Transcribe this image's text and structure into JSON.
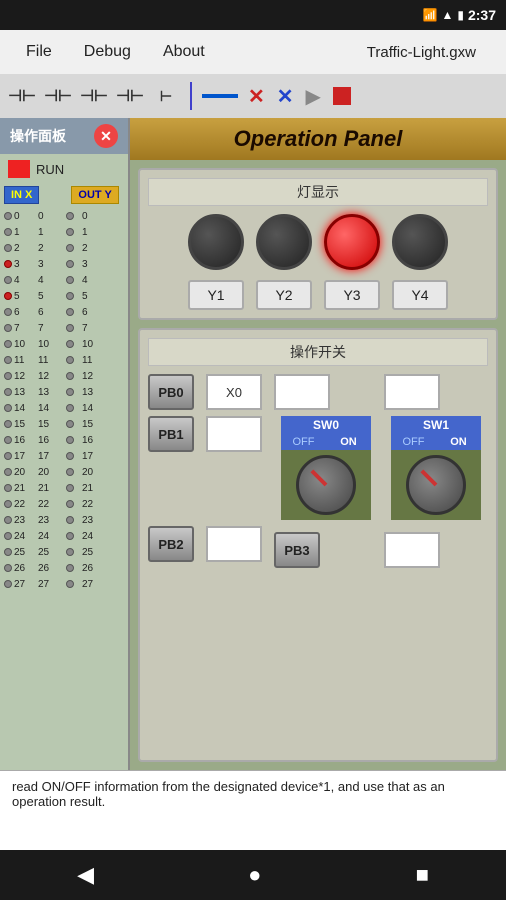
{
  "statusBar": {
    "time": "2:37",
    "wifi": "▼▲",
    "signal": "▲▲▲",
    "battery": "🔋"
  },
  "menuBar": {
    "file": "File",
    "debug": "Debug",
    "about": "About",
    "title": "Traffic-Light.gxw"
  },
  "toolbar": {
    "buttons": [
      "HH",
      "HH",
      "HH",
      "HH",
      "H"
    ]
  },
  "leftPanel": {
    "title": "操作面板",
    "run": "RUN",
    "inHeader": "IN X",
    "outHeader": "OUT Y",
    "rows": [
      {
        "in": 0,
        "inLed": false,
        "out": 0,
        "outLed": false
      },
      {
        "in": 1,
        "inLed": false,
        "out": 1,
        "outLed": false
      },
      {
        "in": 2,
        "inLed": false,
        "out": 2,
        "outLed": false
      },
      {
        "in": 3,
        "inLed": true,
        "out": 3,
        "outLed": false
      },
      {
        "in": 4,
        "inLed": false,
        "out": 4,
        "outLed": false
      },
      {
        "in": 5,
        "inLed": true,
        "out": 5,
        "outLed": false
      },
      {
        "in": 6,
        "inLed": false,
        "out": 6,
        "outLed": false
      },
      {
        "in": 7,
        "inLed": false,
        "out": 7,
        "outLed": false
      },
      {
        "in": 10,
        "inLed": false,
        "out": 10,
        "outLed": false
      },
      {
        "in": 11,
        "inLed": false,
        "out": 11,
        "outLed": false
      },
      {
        "in": 12,
        "inLed": false,
        "out": 12,
        "outLed": false
      },
      {
        "in": 13,
        "inLed": false,
        "out": 13,
        "outLed": false
      },
      {
        "in": 14,
        "inLed": false,
        "out": 14,
        "outLed": false
      },
      {
        "in": 15,
        "inLed": false,
        "out": 15,
        "outLed": false
      },
      {
        "in": 16,
        "inLed": false,
        "out": 16,
        "outLed": false
      },
      {
        "in": 17,
        "inLed": false,
        "out": 17,
        "outLed": false
      },
      {
        "in": 20,
        "inLed": false,
        "out": 20,
        "outLed": false
      },
      {
        "in": 21,
        "inLed": false,
        "out": 21,
        "outLed": false
      },
      {
        "in": 22,
        "inLed": false,
        "out": 22,
        "outLed": false
      },
      {
        "in": 23,
        "inLed": false,
        "out": 23,
        "outLed": false
      },
      {
        "in": 24,
        "inLed": false,
        "out": 24,
        "outLed": false
      },
      {
        "in": 25,
        "inLed": false,
        "out": 25,
        "outLed": false
      },
      {
        "in": 26,
        "inLed": false,
        "out": 26,
        "outLed": false
      },
      {
        "in": 27,
        "inLed": false,
        "out": 27,
        "outLed": false
      }
    ]
  },
  "opPanel": {
    "title": "Operation Panel",
    "lightSection": {
      "title": "灯显示",
      "lights": [
        {
          "id": "Y1",
          "on": false
        },
        {
          "id": "Y2",
          "on": false
        },
        {
          "id": "Y3",
          "on": true
        },
        {
          "id": "Y4",
          "on": false
        }
      ]
    },
    "switchSection": {
      "title": "操作开关",
      "buttons": [
        "PB0",
        "PB1",
        "PB2",
        "PB3"
      ],
      "x0Label": "X0",
      "sw0Label": "SW0",
      "sw1Label": "SW1",
      "offLabel": "OFF",
      "onLabel": "ON"
    }
  },
  "bottomText": "read ON/OFF information from the designated device*1, and use that as an operation result.",
  "navBar": {
    "back": "◀",
    "home": "●",
    "recent": "■"
  }
}
